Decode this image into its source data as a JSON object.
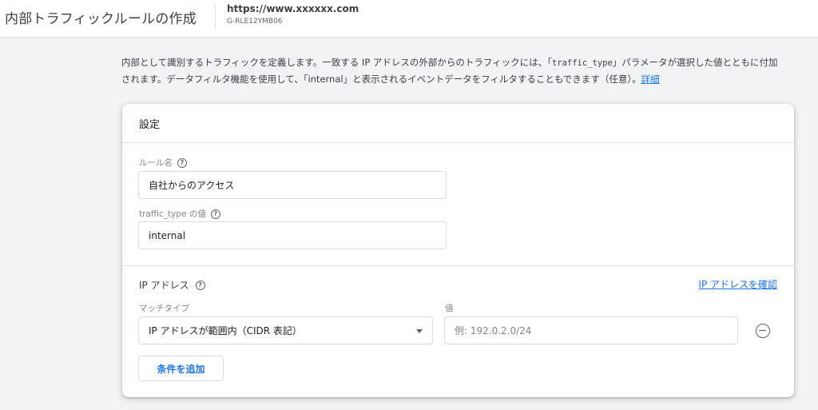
{
  "header": {
    "title": "内部トラフィックルールの作成",
    "site_url": "https://www.xxxxxx.com",
    "measurement_id": "G-RLE12YMB06"
  },
  "description": {
    "part1": "内部として識別するトラフィックを定義します。一致する IP アドレスの外部からのトラフィックには、「",
    "param": "traffic_type",
    "part2": "」パラメータが選択した値とともに付加されます。データフィルタ機能を使用して、「internal」と表示されるイベントデータをフィルタすることもできます（任意）。",
    "link": "詳細"
  },
  "card": {
    "title": "設定",
    "rule_name": {
      "label": "ルール名",
      "value": "自社からのアクセス"
    },
    "traffic_type": {
      "label": "traffic_type の値",
      "value": "internal"
    },
    "ip_section": {
      "title": "IP アドレス",
      "verify_link": "IP アドレスを確認",
      "match_type_label": "マッチタイプ",
      "match_type_value": "IP アドレスが範囲内（CIDR 表記）",
      "value_label": "値",
      "value_placeholder": "例: 192.0.2.0/24",
      "add_condition": "条件を追加"
    }
  },
  "colors": {
    "accent": "#1a73e8",
    "background": "#f1f3f4"
  },
  "icons": [
    "help-icon",
    "chevron-down-icon",
    "remove-circle-icon"
  ]
}
